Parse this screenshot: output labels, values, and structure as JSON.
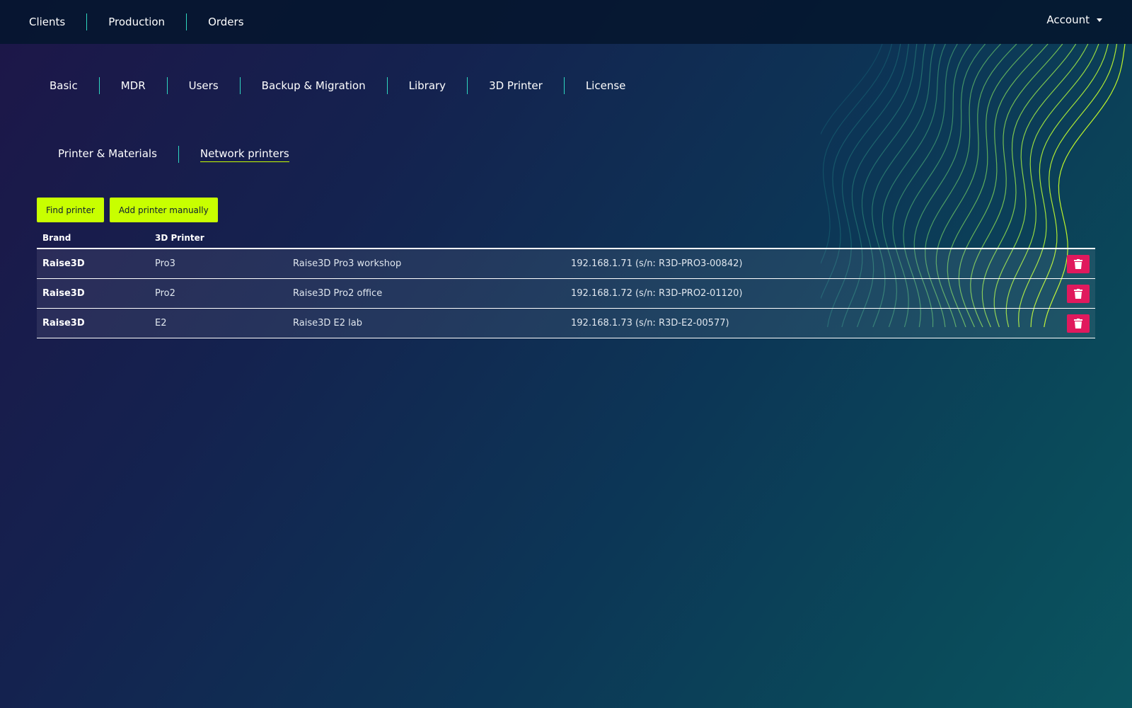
{
  "topnav": {
    "items": [
      "Clients",
      "Production",
      "Orders"
    ],
    "account_label": "Account"
  },
  "settings_nav": {
    "items": [
      "Basic",
      "MDR",
      "Users",
      "Backup & Migration",
      "Library",
      "3D Printer",
      "License"
    ]
  },
  "sub_nav": {
    "items": [
      "Printer & Materials",
      "Network printers"
    ],
    "active": "Network printers"
  },
  "actions": {
    "find_label": "Find printer",
    "add_label": "Add printer manually"
  },
  "table": {
    "headers": {
      "brand": "Brand",
      "printer": "3D Printer"
    },
    "rows": [
      {
        "brand": "Raise3D",
        "model": "Pro3",
        "name": "Raise3D Pro3 workshop",
        "address": "192.168.1.71 (s/n: R3D-PRO3-00842)"
      },
      {
        "brand": "Raise3D",
        "model": "Pro2",
        "name": "Raise3D Pro2 office",
        "address": "192.168.1.72 (s/n: R3D-PRO2-01120)"
      },
      {
        "brand": "Raise3D",
        "model": "E2",
        "name": "Raise3D E2 lab",
        "address": "192.168.1.73 (s/n: R3D-E2-00577)"
      }
    ]
  },
  "icons": {
    "delete": "trash-icon",
    "account_caret": "caret-down-icon"
  },
  "colors": {
    "accent": "#c8ff00",
    "separator": "#2fd7c1",
    "danger": "#e0195d",
    "topbar": "#04162d"
  }
}
